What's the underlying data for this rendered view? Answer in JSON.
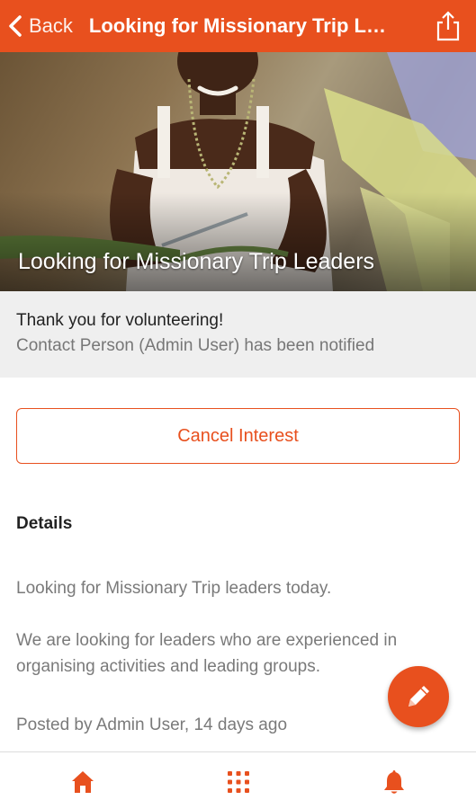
{
  "header": {
    "back_label": "Back",
    "title": "Looking for Missionary Trip Lead...",
    "accent_color": "#e8501e"
  },
  "hero": {
    "title": "Looking for Missionary Trip Leaders"
  },
  "notice": {
    "title": "Thank you for volunteering!",
    "subtitle": "Contact Person (Admin User) has been notified"
  },
  "actions": {
    "cancel_label": "Cancel Interest"
  },
  "details": {
    "heading": "Details",
    "paragraphs": [
      "Looking for Missionary Trip leaders today.",
      "We are looking for leaders who are experienced in organising activities and leading groups."
    ],
    "posted": "Posted by Admin User, 14 days ago"
  },
  "icons": {
    "back": "chevron-left-icon",
    "share": "share-icon",
    "edit": "pencil-icon",
    "nav": [
      "home-icon",
      "grid-icon",
      "bell-icon"
    ]
  }
}
